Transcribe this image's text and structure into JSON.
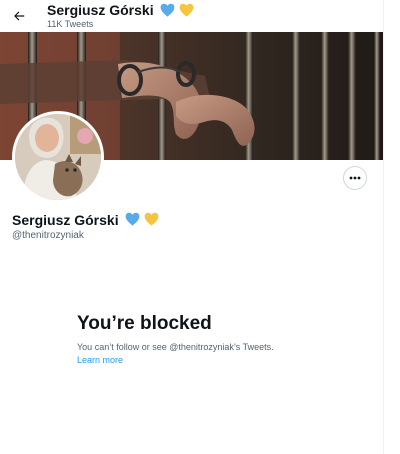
{
  "header": {
    "back_icon": "arrow-left-icon",
    "name": "Sergiusz Górski",
    "tweet_count": "11K Tweets"
  },
  "profile": {
    "display_name": "Sergiusz Górski",
    "handle": "@thenitrozyniak",
    "badges": [
      "blue-heart-icon",
      "yellow-heart-icon"
    ],
    "more_icon": "more-horizontal-icon"
  },
  "blocked": {
    "title": "You’re blocked",
    "description": "You can’t follow or see @thenitrozyniak’s Tweets.",
    "learn_more": "Learn more"
  },
  "colors": {
    "accent": "#1d9bf0",
    "secondary_text": "#536471",
    "heart_blue": "#5aaae8",
    "heart_yellow": "#f5c542"
  }
}
